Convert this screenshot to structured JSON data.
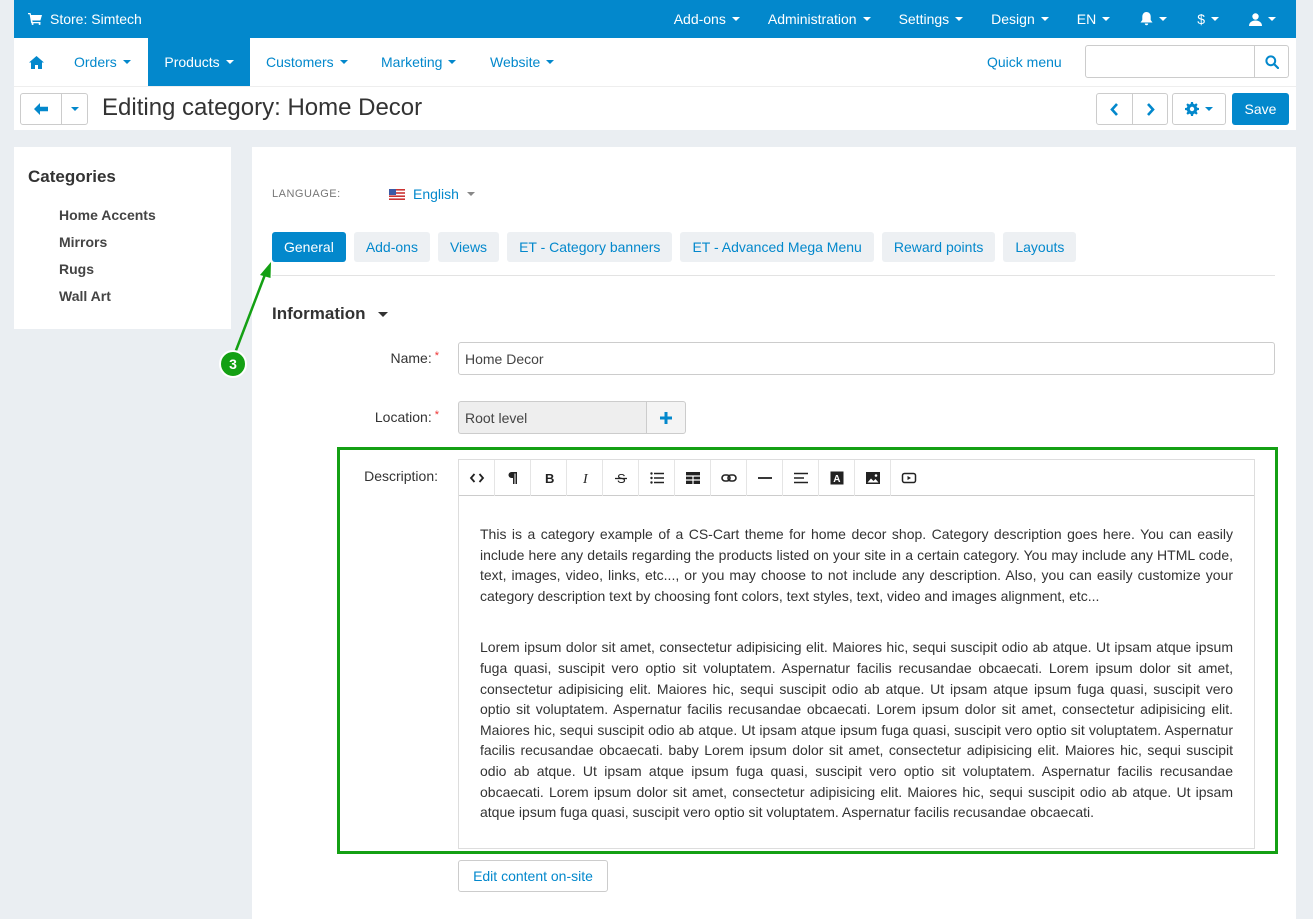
{
  "topbar": {
    "store_label": "Store: Simtech",
    "menu": [
      "Add-ons",
      "Administration",
      "Settings",
      "Design",
      "EN"
    ],
    "currency": "$"
  },
  "nav": {
    "items": [
      "Orders",
      "Products",
      "Customers",
      "Marketing",
      "Website"
    ],
    "active": "Products",
    "quick_menu": "Quick menu",
    "search_placeholder": ""
  },
  "page": {
    "title": "Editing category: Home Decor",
    "save_label": "Save"
  },
  "sidebar": {
    "title": "Categories",
    "items": [
      "Home Accents",
      "Mirrors",
      "Rugs",
      "Wall Art"
    ]
  },
  "language": {
    "label": "LANGUAGE:",
    "value": "English"
  },
  "tabs": [
    "General",
    "Add-ons",
    "Views",
    "ET - Category banners",
    "ET - Advanced Mega Menu",
    "Reward points",
    "Layouts"
  ],
  "section": {
    "title": "Information"
  },
  "form": {
    "name_label": "Name:",
    "name_value": "Home Decor",
    "location_label": "Location:",
    "location_value": "Root level",
    "description_label": "Description:",
    "description_paragraphs": [
      "This is a category example of a CS-Cart theme for home decor shop. Category description goes here. You can easily include here any details regarding the products listed on your site in a certain category. You may include any HTML code, text, images, video, links, etc..., or you may choose to not include any description. Also, you can easily customize your category description text by choosing font colors, text styles, text, video and images alignment, etc...",
      "Lorem ipsum dolor sit amet, consectetur adipisicing elit. Maiores hic, sequi suscipit odio ab atque. Ut ipsam atque ipsum fuga quasi, suscipit vero optio sit voluptatem. Aspernatur facilis recusandae obcaecati. Lorem ipsum dolor sit amet, consectetur adipisicing elit. Maiores hic, sequi suscipit odio ab atque. Ut ipsam atque ipsum fuga quasi, suscipit vero optio sit voluptatem. Aspernatur facilis recusandae obcaecati. Lorem ipsum dolor sit amet, consectetur adipisicing elit. Maiores hic, sequi suscipit odio ab atque. Ut ipsam atque ipsum fuga quasi, suscipit vero optio sit voluptatem. Aspernatur facilis recusandae obcaecati. baby Lorem ipsum dolor sit amet, consectetur adipisicing elit. Maiores hic, sequi suscipit odio ab atque. Ut ipsam atque ipsum fuga quasi, suscipit vero optio sit voluptatem. Aspernatur facilis recusandae obcaecati. Lorem ipsum dolor sit amet, consectetur adipisicing elit. Maiores hic, sequi suscipit odio ab atque. Ut ipsam atque ipsum fuga quasi, suscipit vero optio sit voluptatem. Aspernatur facilis recusandae obcaecati."
    ],
    "edit_onsite_label": "Edit content on-site"
  },
  "toolbar_icons": [
    "code-view-icon",
    "paragraph-icon",
    "bold-icon",
    "italic-icon",
    "strikethrough-icon",
    "unordered-list-icon",
    "table-icon",
    "link-icon",
    "horizontal-rule-icon",
    "align-icon",
    "font-color-icon",
    "image-icon",
    "video-icon"
  ],
  "annotation": {
    "step": "3",
    "color": "#14a014"
  },
  "colors": {
    "accent": "#0388cc",
    "background": "#eaeef2",
    "required": "#ee3333"
  }
}
